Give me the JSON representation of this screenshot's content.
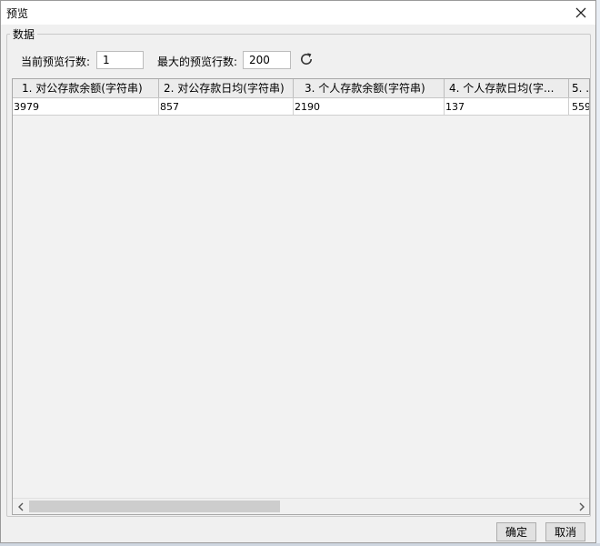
{
  "window": {
    "title": "预览"
  },
  "group": {
    "title": "数据"
  },
  "controls": {
    "current_rows_label": "当前预览行数:",
    "current_rows_value": "1",
    "max_rows_label": "最大的预览行数:",
    "max_rows_value": "200"
  },
  "table": {
    "columns": [
      "1. 对公存款余额(字符串)",
      "2. 对公存款日均(字符串)",
      "3. 个人存款余额(字符串)",
      "4. 个人存款日均(字...",
      "5. ..."
    ],
    "rows": [
      [
        "3979",
        "857",
        "2190",
        "137",
        "559"
      ]
    ]
  },
  "buttons": {
    "ok": "确定",
    "cancel": "取消"
  },
  "icons": {
    "close": "close-icon",
    "refresh": "refresh-icon",
    "left": "chevron-left-icon",
    "right": "chevron-right-icon"
  }
}
